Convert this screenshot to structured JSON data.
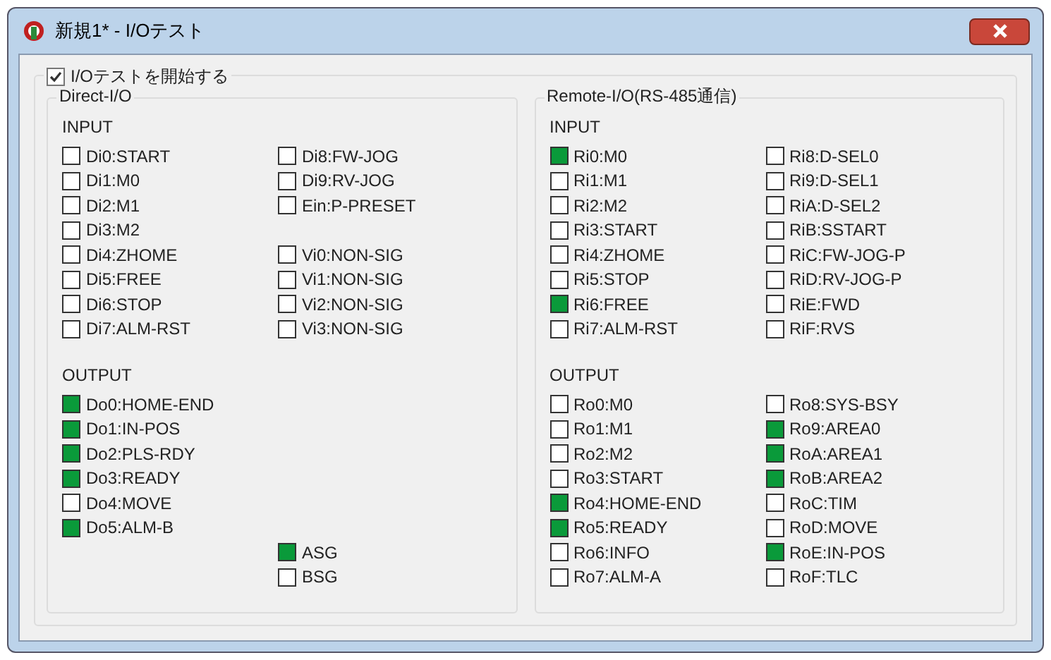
{
  "window": {
    "title": "新規1* - I/Oテスト"
  },
  "start_test": {
    "label": "I/Oテストを開始する",
    "checked": true
  },
  "panels": [
    {
      "title": "Direct-I/O",
      "input": {
        "label": "INPUT",
        "column_1": [
          [
            {
              "label": "Di0:START",
              "on": false
            },
            {
              "label": "Di1:M0",
              "on": false
            },
            {
              "label": "Di2:M1",
              "on": false
            },
            {
              "label": "Di3:M2",
              "on": false
            },
            {
              "label": "Di4:ZHOME",
              "on": false
            },
            {
              "label": "Di5:FREE",
              "on": false
            },
            {
              "label": "Di6:STOP",
              "on": false
            },
            {
              "label": "Di7:ALM-RST",
              "on": false
            }
          ]
        ],
        "column_2": [
          [
            {
              "label": "Di8:FW-JOG",
              "on": false
            },
            {
              "label": "Di9:RV-JOG",
              "on": false
            },
            {
              "label": "Ein:P-PRESET",
              "on": false
            }
          ],
          [
            {
              "label": "Vi0:NON-SIG",
              "on": false
            },
            {
              "label": "Vi1:NON-SIG",
              "on": false
            },
            {
              "label": "Vi2:NON-SIG",
              "on": false
            },
            {
              "label": "Vi3:NON-SIG",
              "on": false
            }
          ]
        ]
      },
      "output": {
        "label": "OUTPUT",
        "column_1": [
          [
            {
              "label": "Do0:HOME-END",
              "on": true
            },
            {
              "label": "Do1:IN-POS",
              "on": true
            },
            {
              "label": "Do2:PLS-RDY",
              "on": true
            },
            {
              "label": "Do3:READY",
              "on": true
            },
            {
              "label": "Do4:MOVE",
              "on": false
            },
            {
              "label": "Do5:ALM-B",
              "on": true
            }
          ]
        ],
        "column_2_bottom": [
          {
            "label": "ASG",
            "on": true
          },
          {
            "label": "BSG",
            "on": false
          }
        ]
      }
    },
    {
      "title": "Remote-I/O(RS-485通信)",
      "input": {
        "label": "INPUT",
        "column_1": [
          [
            {
              "label": "Ri0:M0",
              "on": true
            },
            {
              "label": "Ri1:M1",
              "on": false
            },
            {
              "label": "Ri2:M2",
              "on": false
            },
            {
              "label": "Ri3:START",
              "on": false
            },
            {
              "label": "Ri4:ZHOME",
              "on": false
            },
            {
              "label": "Ri5:STOP",
              "on": false
            },
            {
              "label": "Ri6:FREE",
              "on": true
            },
            {
              "label": "Ri7:ALM-RST",
              "on": false
            }
          ]
        ],
        "column_2": [
          [
            {
              "label": "Ri8:D-SEL0",
              "on": false
            },
            {
              "label": "Ri9:D-SEL1",
              "on": false
            },
            {
              "label": "RiA:D-SEL2",
              "on": false
            },
            {
              "label": "RiB:SSTART",
              "on": false
            },
            {
              "label": "RiC:FW-JOG-P",
              "on": false
            },
            {
              "label": "RiD:RV-JOG-P",
              "on": false
            },
            {
              "label": "RiE:FWD",
              "on": false
            },
            {
              "label": "RiF:RVS",
              "on": false
            }
          ]
        ]
      },
      "output": {
        "label": "OUTPUT",
        "column_1": [
          [
            {
              "label": "Ro0:M0",
              "on": false
            },
            {
              "label": "Ro1:M1",
              "on": false
            },
            {
              "label": "Ro2:M2",
              "on": false
            },
            {
              "label": "Ro3:START",
              "on": false
            },
            {
              "label": "Ro4:HOME-END",
              "on": true
            },
            {
              "label": "Ro5:READY",
              "on": true
            },
            {
              "label": "Ro6:INFO",
              "on": false
            },
            {
              "label": "Ro7:ALM-A",
              "on": false
            }
          ]
        ],
        "column_2": [
          [
            {
              "label": "Ro8:SYS-BSY",
              "on": false
            },
            {
              "label": "Ro9:AREA0",
              "on": true
            },
            {
              "label": "RoA:AREA1",
              "on": true
            },
            {
              "label": "RoB:AREA2",
              "on": true
            },
            {
              "label": "RoC:TIM",
              "on": false
            },
            {
              "label": "RoD:MOVE",
              "on": false
            },
            {
              "label": "RoE:IN-POS",
              "on": true
            },
            {
              "label": "RoF:TLC",
              "on": false
            }
          ]
        ]
      }
    }
  ]
}
